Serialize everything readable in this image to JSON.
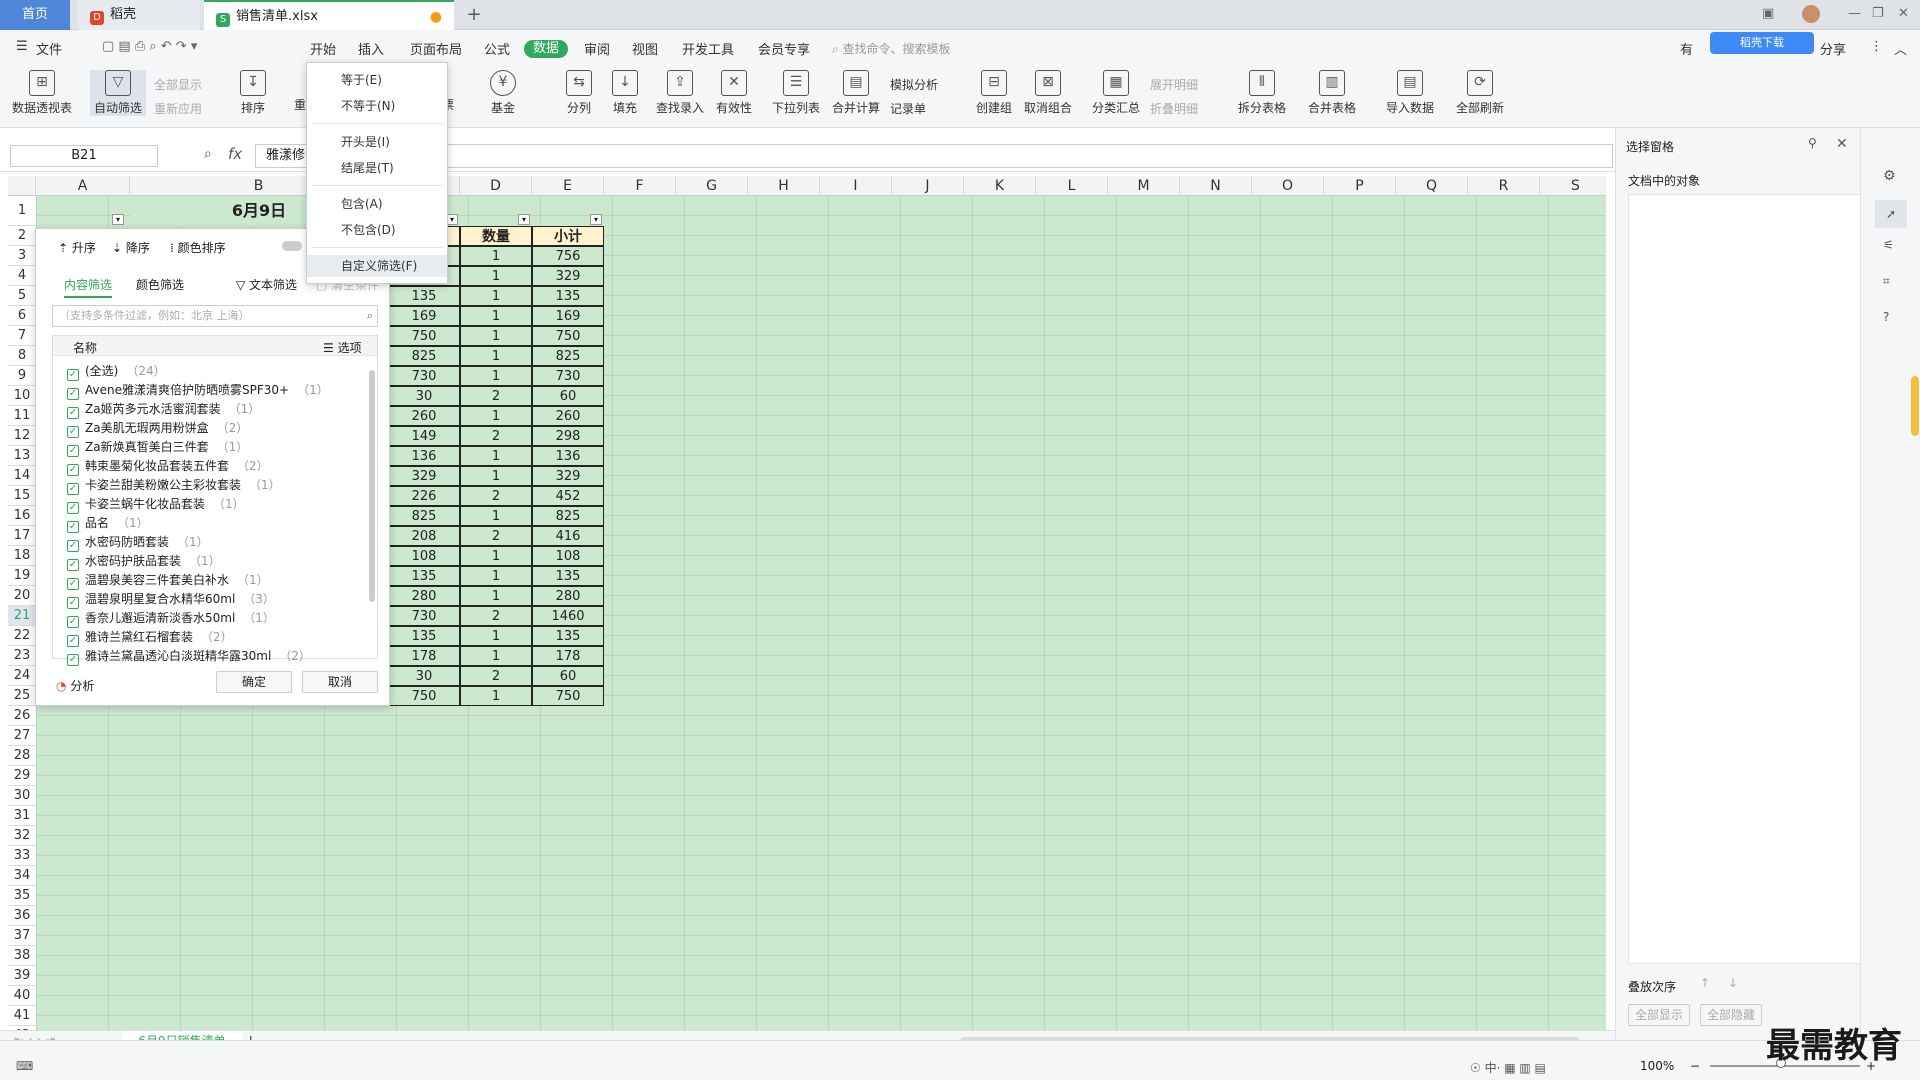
{
  "tabs": {
    "home": "首页",
    "daoke": "稻壳",
    "file": "销售清单.xlsx",
    "add": "+"
  },
  "menubar": {
    "file": "文件",
    "items": [
      "开始",
      "插入",
      "页面布局",
      "公式",
      "数据",
      "审阅",
      "视图",
      "开发工具",
      "会员专享"
    ],
    "search": "查找命令、搜索模板",
    "share": "分享",
    "sync": "有",
    "badge": "稻壳下载"
  },
  "ribbon": {
    "pivot": "数据透视表",
    "autofilter": "自动筛选",
    "showall": "全部显示",
    "reapply": "重新应用",
    "sort": "排序",
    "redo": "重",
    "fund": "基金",
    "split": "分列",
    "fill": "填充",
    "lookup": "查找录入",
    "validity": "有效性",
    "dropdown": "下拉列表",
    "merge_calc": "合并计算",
    "simulate": "模拟分析",
    "record": "记录单",
    "group": "创建组",
    "ungroup": "取消组合",
    "subtotal": "分类汇总",
    "expand": "展开明细",
    "collapse": "折叠明细",
    "split_table": "拆分表格",
    "merge_table": "合并表格",
    "import": "导入数据",
    "refresh_all": "全部刷新",
    "biao": "票"
  },
  "formula": {
    "namebox": "B21",
    "fx": "fx",
    "value": "雅漾修"
  },
  "columns": [
    "A",
    "B",
    "C",
    "D",
    "E",
    "F",
    "G",
    "H",
    "I",
    "J",
    "K",
    "L",
    "M",
    "N",
    "O",
    "P",
    "Q",
    "R",
    "S"
  ],
  "rows": [
    "1",
    "2",
    "3",
    "4",
    "5",
    "6",
    "7",
    "8",
    "9",
    "10",
    "11",
    "12",
    "13",
    "14",
    "15",
    "16",
    "17",
    "18",
    "19",
    "20",
    "21",
    "22",
    "23",
    "24",
    "25",
    "26",
    "27",
    "28",
    "29",
    "30",
    "31",
    "32",
    "33",
    "34",
    "35",
    "36",
    "37",
    "38",
    "39",
    "40",
    "41",
    "42",
    "43"
  ],
  "table": {
    "title": "6月9日",
    "headers": {
      "qty": "数量",
      "subtotal": "小计"
    },
    "price": [
      "756",
      "329",
      "135",
      "169",
      "750",
      "825",
      "730",
      "30",
      "260",
      "149",
      "136",
      "329",
      "226",
      "825",
      "208",
      "108",
      "135",
      "280",
      "730",
      "135",
      "178",
      "30",
      "750"
    ],
    "qty": [
      "1",
      "1",
      "1",
      "1",
      "1",
      "1",
      "1",
      "2",
      "1",
      "2",
      "1",
      "1",
      "2",
      "1",
      "2",
      "1",
      "1",
      "1",
      "2",
      "1",
      "1",
      "2",
      "1"
    ],
    "sub": [
      "756",
      "329",
      "135",
      "169",
      "750",
      "825",
      "730",
      "60",
      "260",
      "298",
      "136",
      "329",
      "452",
      "825",
      "416",
      "108",
      "135",
      "280",
      "1460",
      "135",
      "178",
      "60",
      "750"
    ]
  },
  "filter_popup": {
    "asc": "升序",
    "desc": "降序",
    "color_sort": "颜色排序",
    "tab_content": "内容筛选",
    "tab_color": "颜色筛选",
    "text_filter": "文本筛选",
    "clear": "清空条件",
    "search_placeholder": "（支持多条件过滤，例如：北京 上海）",
    "col_name": "名称",
    "options": "选项",
    "items": [
      {
        "label": "(全选)",
        "count": "（24）"
      },
      {
        "label": "Avene雅漾清爽倍护防晒喷雾SPF30+",
        "count": "（1）"
      },
      {
        "label": "Za姬芮多元水活蜜润套装",
        "count": "（1）"
      },
      {
        "label": "Za美肌无瑕两用粉饼盒",
        "count": "（2）"
      },
      {
        "label": "Za新焕真皙美白三件套",
        "count": "（1）"
      },
      {
        "label": "韩束墨菊化妆品套装五件套",
        "count": "（2）"
      },
      {
        "label": "卡姿兰甜美粉嫩公主彩妆套装",
        "count": "（1）"
      },
      {
        "label": "卡姿兰蜗牛化妆品套装",
        "count": "（1）"
      },
      {
        "label": "品名",
        "count": "（1）"
      },
      {
        "label": "水密码防晒套装",
        "count": "（1）"
      },
      {
        "label": "水密码护肤品套装",
        "count": "（1）"
      },
      {
        "label": "温碧泉美容三件套美白补水",
        "count": "（1）"
      },
      {
        "label": "温碧泉明星复合水精华60ml",
        "count": "（3）"
      },
      {
        "label": "香奈儿邂逅清新淡香水50ml",
        "count": "（1）"
      },
      {
        "label": "雅诗兰黛红石榴套装",
        "count": "（2）"
      },
      {
        "label": "雅诗兰黛晶透沁白淡斑精华露30ml",
        "count": "（2）"
      }
    ],
    "analysis": "分析",
    "ok": "确定",
    "cancel": "取消"
  },
  "context_menu": {
    "equal": "等于(E)",
    "not_equal": "不等于(N)",
    "begins": "开头是(I)",
    "ends": "结尾是(T)",
    "contains": "包含(A)",
    "not_contains": "不包含(D)",
    "custom": "自定义筛选(F)"
  },
  "right_pane": {
    "title": "选择窗格",
    "objects": "文档中的对象",
    "order": "叠放次序",
    "show_all": "全部显示",
    "hide_all": "全部隐藏"
  },
  "sheet_tab": "6月9日销售清单",
  "status": {
    "zoom": "100%",
    "watermark": "最需教育"
  }
}
